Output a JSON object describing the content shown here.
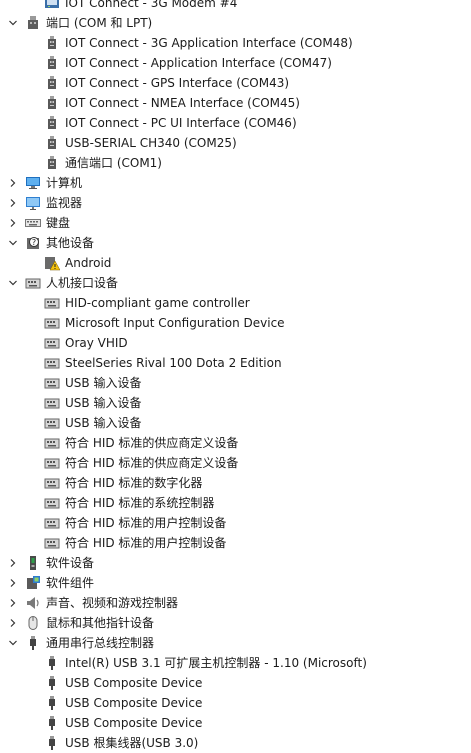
{
  "tree": [
    {
      "level": 1,
      "icon": "modem-icon",
      "label": "IOT Connect - 3G Modem #4"
    },
    {
      "level": 0,
      "expanded": true,
      "icon": "port-icon",
      "label": "端口 (COM 和 LPT)"
    },
    {
      "level": 1,
      "icon": "port-connector-icon",
      "label": "IOT Connect - 3G Application Interface (COM48)"
    },
    {
      "level": 1,
      "icon": "port-connector-icon",
      "label": "IOT Connect - Application Interface (COM47)"
    },
    {
      "level": 1,
      "icon": "port-connector-icon",
      "label": "IOT Connect - GPS Interface (COM43)"
    },
    {
      "level": 1,
      "icon": "port-connector-icon",
      "label": "IOT Connect - NMEA Interface (COM45)"
    },
    {
      "level": 1,
      "icon": "port-connector-icon",
      "label": "IOT Connect - PC UI Interface (COM46)"
    },
    {
      "level": 1,
      "icon": "port-connector-icon",
      "label": "USB-SERIAL CH340 (COM25)"
    },
    {
      "level": 1,
      "icon": "port-connector-icon",
      "label": "通信端口 (COM1)"
    },
    {
      "level": 0,
      "expanded": false,
      "icon": "computer-icon",
      "label": "计算机"
    },
    {
      "level": 0,
      "expanded": false,
      "icon": "monitor-icon",
      "label": "监视器"
    },
    {
      "level": 0,
      "expanded": false,
      "icon": "keyboard-icon",
      "label": "键盘"
    },
    {
      "level": 0,
      "expanded": true,
      "icon": "unknown-device-icon",
      "label": "其他设备"
    },
    {
      "level": 1,
      "icon": "warning-device-icon",
      "label": "Android"
    },
    {
      "level": 0,
      "expanded": true,
      "icon": "hid-icon",
      "label": "人机接口设备"
    },
    {
      "level": 1,
      "icon": "hid-icon",
      "label": "HID-compliant game controller"
    },
    {
      "level": 1,
      "icon": "hid-icon",
      "label": "Microsoft Input Configuration Device"
    },
    {
      "level": 1,
      "icon": "hid-icon",
      "label": "Oray VHID"
    },
    {
      "level": 1,
      "icon": "hid-icon",
      "label": "SteelSeries Rival 100 Dota 2 Edition"
    },
    {
      "level": 1,
      "icon": "hid-icon",
      "label": "USB 输入设备"
    },
    {
      "level": 1,
      "icon": "hid-icon",
      "label": "USB 输入设备"
    },
    {
      "level": 1,
      "icon": "hid-icon",
      "label": "USB 输入设备"
    },
    {
      "level": 1,
      "icon": "hid-icon",
      "label": "符合 HID 标准的供应商定义设备"
    },
    {
      "level": 1,
      "icon": "hid-icon",
      "label": "符合 HID 标准的供应商定义设备"
    },
    {
      "level": 1,
      "icon": "hid-icon",
      "label": "符合 HID 标准的数字化器"
    },
    {
      "level": 1,
      "icon": "hid-icon",
      "label": "符合 HID 标准的系统控制器"
    },
    {
      "level": 1,
      "icon": "hid-icon",
      "label": "符合 HID 标准的用户控制设备"
    },
    {
      "level": 1,
      "icon": "hid-icon",
      "label": "符合 HID 标准的用户控制设备"
    },
    {
      "level": 0,
      "expanded": false,
      "icon": "software-device-icon",
      "label": "软件设备"
    },
    {
      "level": 0,
      "expanded": false,
      "icon": "software-component-icon",
      "label": "软件组件"
    },
    {
      "level": 0,
      "expanded": false,
      "icon": "speaker-icon",
      "label": "声音、视频和游戏控制器"
    },
    {
      "level": 0,
      "expanded": false,
      "icon": "mouse-icon",
      "label": "鼠标和其他指针设备"
    },
    {
      "level": 0,
      "expanded": true,
      "icon": "usb-icon",
      "label": "通用串行总线控制器"
    },
    {
      "level": 1,
      "icon": "usb-icon",
      "label": "Intel(R) USB 3.1 可扩展主机控制器 - 1.10 (Microsoft)"
    },
    {
      "level": 1,
      "icon": "usb-icon",
      "label": "USB Composite Device"
    },
    {
      "level": 1,
      "icon": "usb-icon",
      "label": "USB Composite Device"
    },
    {
      "level": 1,
      "icon": "usb-icon",
      "label": "USB Composite Device"
    },
    {
      "level": 1,
      "icon": "usb-icon",
      "label": "USB 根集线器(USB 3.0)"
    }
  ]
}
